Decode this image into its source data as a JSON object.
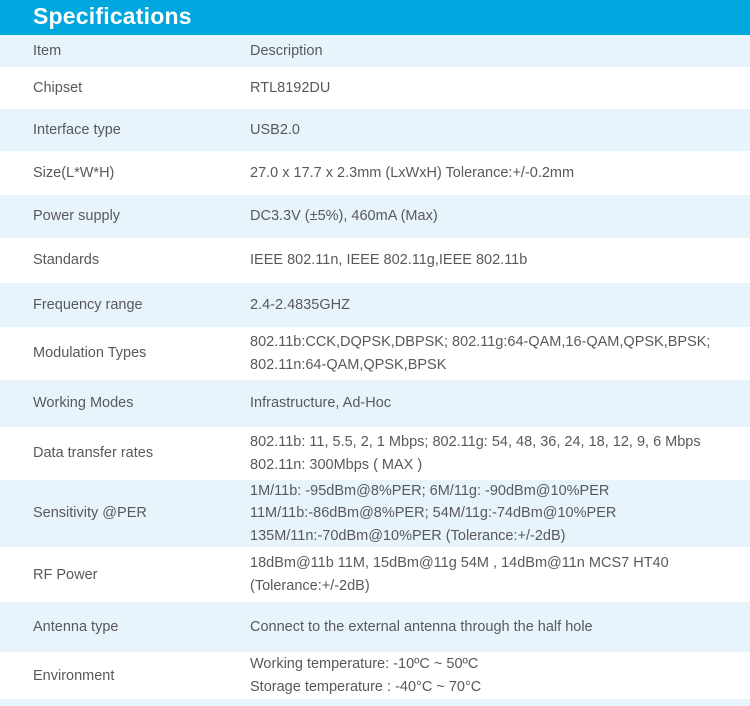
{
  "header": {
    "title": "Specifications",
    "bar_color": "#00a6de",
    "title_color": "#ffffff"
  },
  "table": {
    "alt_row_color": "#e8f4fc",
    "row_color": "#ffffff",
    "text_color": "#595959",
    "columns": {
      "item_header": "Item",
      "description_header": "Description"
    },
    "rows": [
      {
        "item": "Chipset",
        "lines": [
          "RTL8192DU"
        ]
      },
      {
        "item": "Interface type",
        "lines": [
          "USB2.0"
        ]
      },
      {
        "item": "Size(L*W*H)",
        "lines": [
          "27.0 x 17.7 x 2.3mm (LxWxH) Tolerance:+/-0.2mm"
        ]
      },
      {
        "item": "Power supply",
        "lines": [
          "DC3.3V (±5%), 460mA (Max)"
        ]
      },
      {
        "item": "Standards",
        "lines": [
          "IEEE 802.11n, IEEE 802.11g,IEEE 802.11b"
        ]
      },
      {
        "item": "Frequency range",
        "lines": [
          "2.4-2.4835GHZ"
        ]
      },
      {
        "item": "Modulation Types",
        "lines": [
          "802.11b:CCK,DQPSK,DBPSK; 802.11g:64-QAM,16-QAM,QPSK,BPSK;",
          "802.11n:64-QAM,QPSK,BPSK"
        ]
      },
      {
        "item": "Working Modes",
        "lines": [
          "Infrastructure,  Ad-Hoc"
        ]
      },
      {
        "item": "Data transfer rates",
        "lines": [
          "802.11b: 11, 5.5, 2, 1 Mbps; 802.11g: 54, 48, 36, 24, 18, 12, 9, 6 Mbps",
          "802.11n: 300Mbps ( MAX )"
        ]
      },
      {
        "item": "Sensitivity @PER",
        "lines": [
          "1M/11b: -95dBm@8%PER;  6M/11g: -90dBm@10%PER",
          "11M/11b:-86dBm@8%PER;  54M/11g:-74dBm@10%PER",
          "135M/11n:-70dBm@10%PER (Tolerance:+/-2dB)"
        ]
      },
      {
        "item": "RF Power",
        "lines": [
          "18dBm@11b 11M,  15dBm@11g 54M ,  14dBm@11n MCS7 HT40",
          "(Tolerance:+/-2dB)"
        ]
      },
      {
        "item": "Antenna type",
        "lines": [
          "Connect to the external antenna through the half hole"
        ]
      },
      {
        "item": "Environment",
        "lines": [
          "Working temperature: -10ºC ~ 50ºC",
          "Storage temperature : -40°C ~ 70°C"
        ]
      }
    ]
  }
}
